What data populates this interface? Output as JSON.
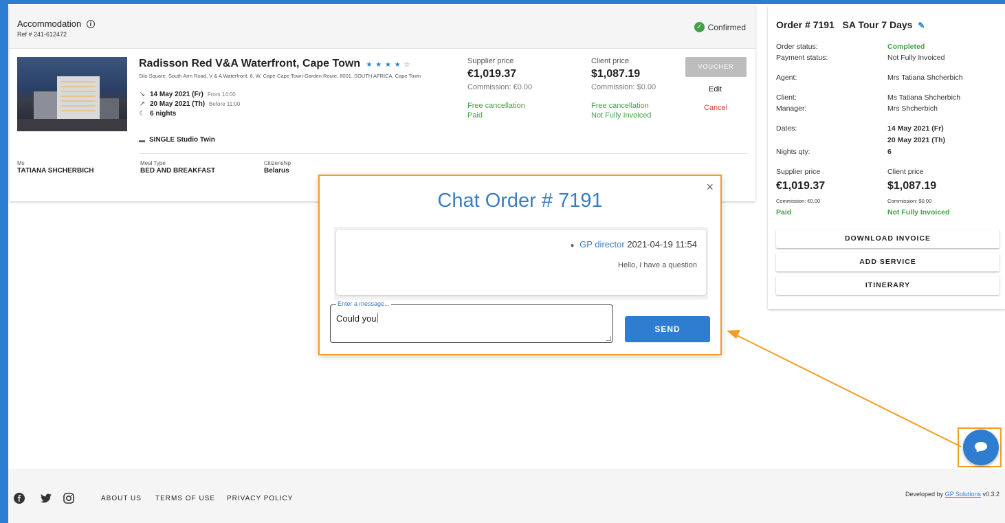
{
  "accommodation": {
    "title": "Accommodation",
    "info_icon": "info-icon",
    "ref": "Ref # 241-612472",
    "status": "Confirmed",
    "hotel_name": "Radisson Red V&A Waterfront, Cape Town",
    "stars": "★ ★ ★ ★ ☆",
    "address": "Silo Square, South Arm Road, V & A Waterfront, 6, W. Cape-Cape Town-Garden Route, 8001, SOUTH AFRICA, Cape Town",
    "checkin_date": "14 May 2021 (Fr)",
    "checkin_note": "From 14:00",
    "checkout_date": "20 May 2021 (Th)",
    "checkout_note": "Before 11:00",
    "nights": "6 nights",
    "room": "SINGLE Studio Twin",
    "supplier_price_label": "Supplier price",
    "supplier_price": "€1,019.37",
    "supplier_commission": "Commission: €0.00",
    "supplier_cancel": "Free cancellation",
    "supplier_payment": "Paid",
    "client_price_label": "Client price",
    "client_price": "$1,087.19",
    "client_commission": "Commission: $0.00",
    "client_cancel": "Free cancellation",
    "client_invoice": "Not Fully Invoiced",
    "voucher_label": "VOUCHER",
    "edit_label": "Edit",
    "cancel_label": "Cancel",
    "guest_title_label": "Ms",
    "guest_name": "TATIANA SHCHERBICH",
    "meal_label": "Meal Type",
    "meal_value": "BED AND BREAKFAST",
    "citizenship_label": "Citizenship",
    "citizenship_value": "Belarus"
  },
  "order": {
    "title": "Order # 7191",
    "tour": "SA Tour 7 Days",
    "order_status_label": "Order status:",
    "order_status": "Completed",
    "payment_status_label": "Payment status:",
    "payment_status": "Not Fully Invoiced",
    "agent_label": "Agent:",
    "agent": "Mrs Tatiana Shcherbich",
    "client_label": "Client:",
    "client": "Ms Tatiana Shcherbich",
    "manager_label": "Manager:",
    "manager": "Mrs Shcherbich",
    "dates_label": "Dates:",
    "date_from": "14 May 2021 (Fr)",
    "date_to": "20 May 2021 (Th)",
    "nights_label": "Nights qty:",
    "nights": "6",
    "supplier_price_label": "Supplier price",
    "supplier_price": "€1,019.37",
    "supplier_commission": "Commission: €0.00",
    "supplier_payment": "Paid",
    "client_price_label": "Client price",
    "client_price": "$1,087.19",
    "client_commission": "Commission: $0.00",
    "client_invoice": "Not Fully Invoiced",
    "download_invoice_label": "DOWNLOAD INVOICE",
    "add_service_label": "ADD SERVICE",
    "itinerary_label": "ITINERARY"
  },
  "chat": {
    "title": "Chat Order # 7191",
    "close_label": "×",
    "message_author": "GP director",
    "message_time": "2021-04-19 11:54",
    "message_text": "Hello, I have a question",
    "input_label": "Enter a message...",
    "input_value": "Could you",
    "send_label": "SEND"
  },
  "footer": {
    "about": "ABOUT US",
    "terms": "TERMS OF USE",
    "privacy": "PRIVACY POLICY",
    "developed_by": "Developed by",
    "developer": "GP Solutions",
    "version": "v0.3.2"
  },
  "colors": {
    "accent": "#2f7dd1",
    "highlight": "#f39c21",
    "success": "#43a047",
    "danger": "#e53935"
  }
}
